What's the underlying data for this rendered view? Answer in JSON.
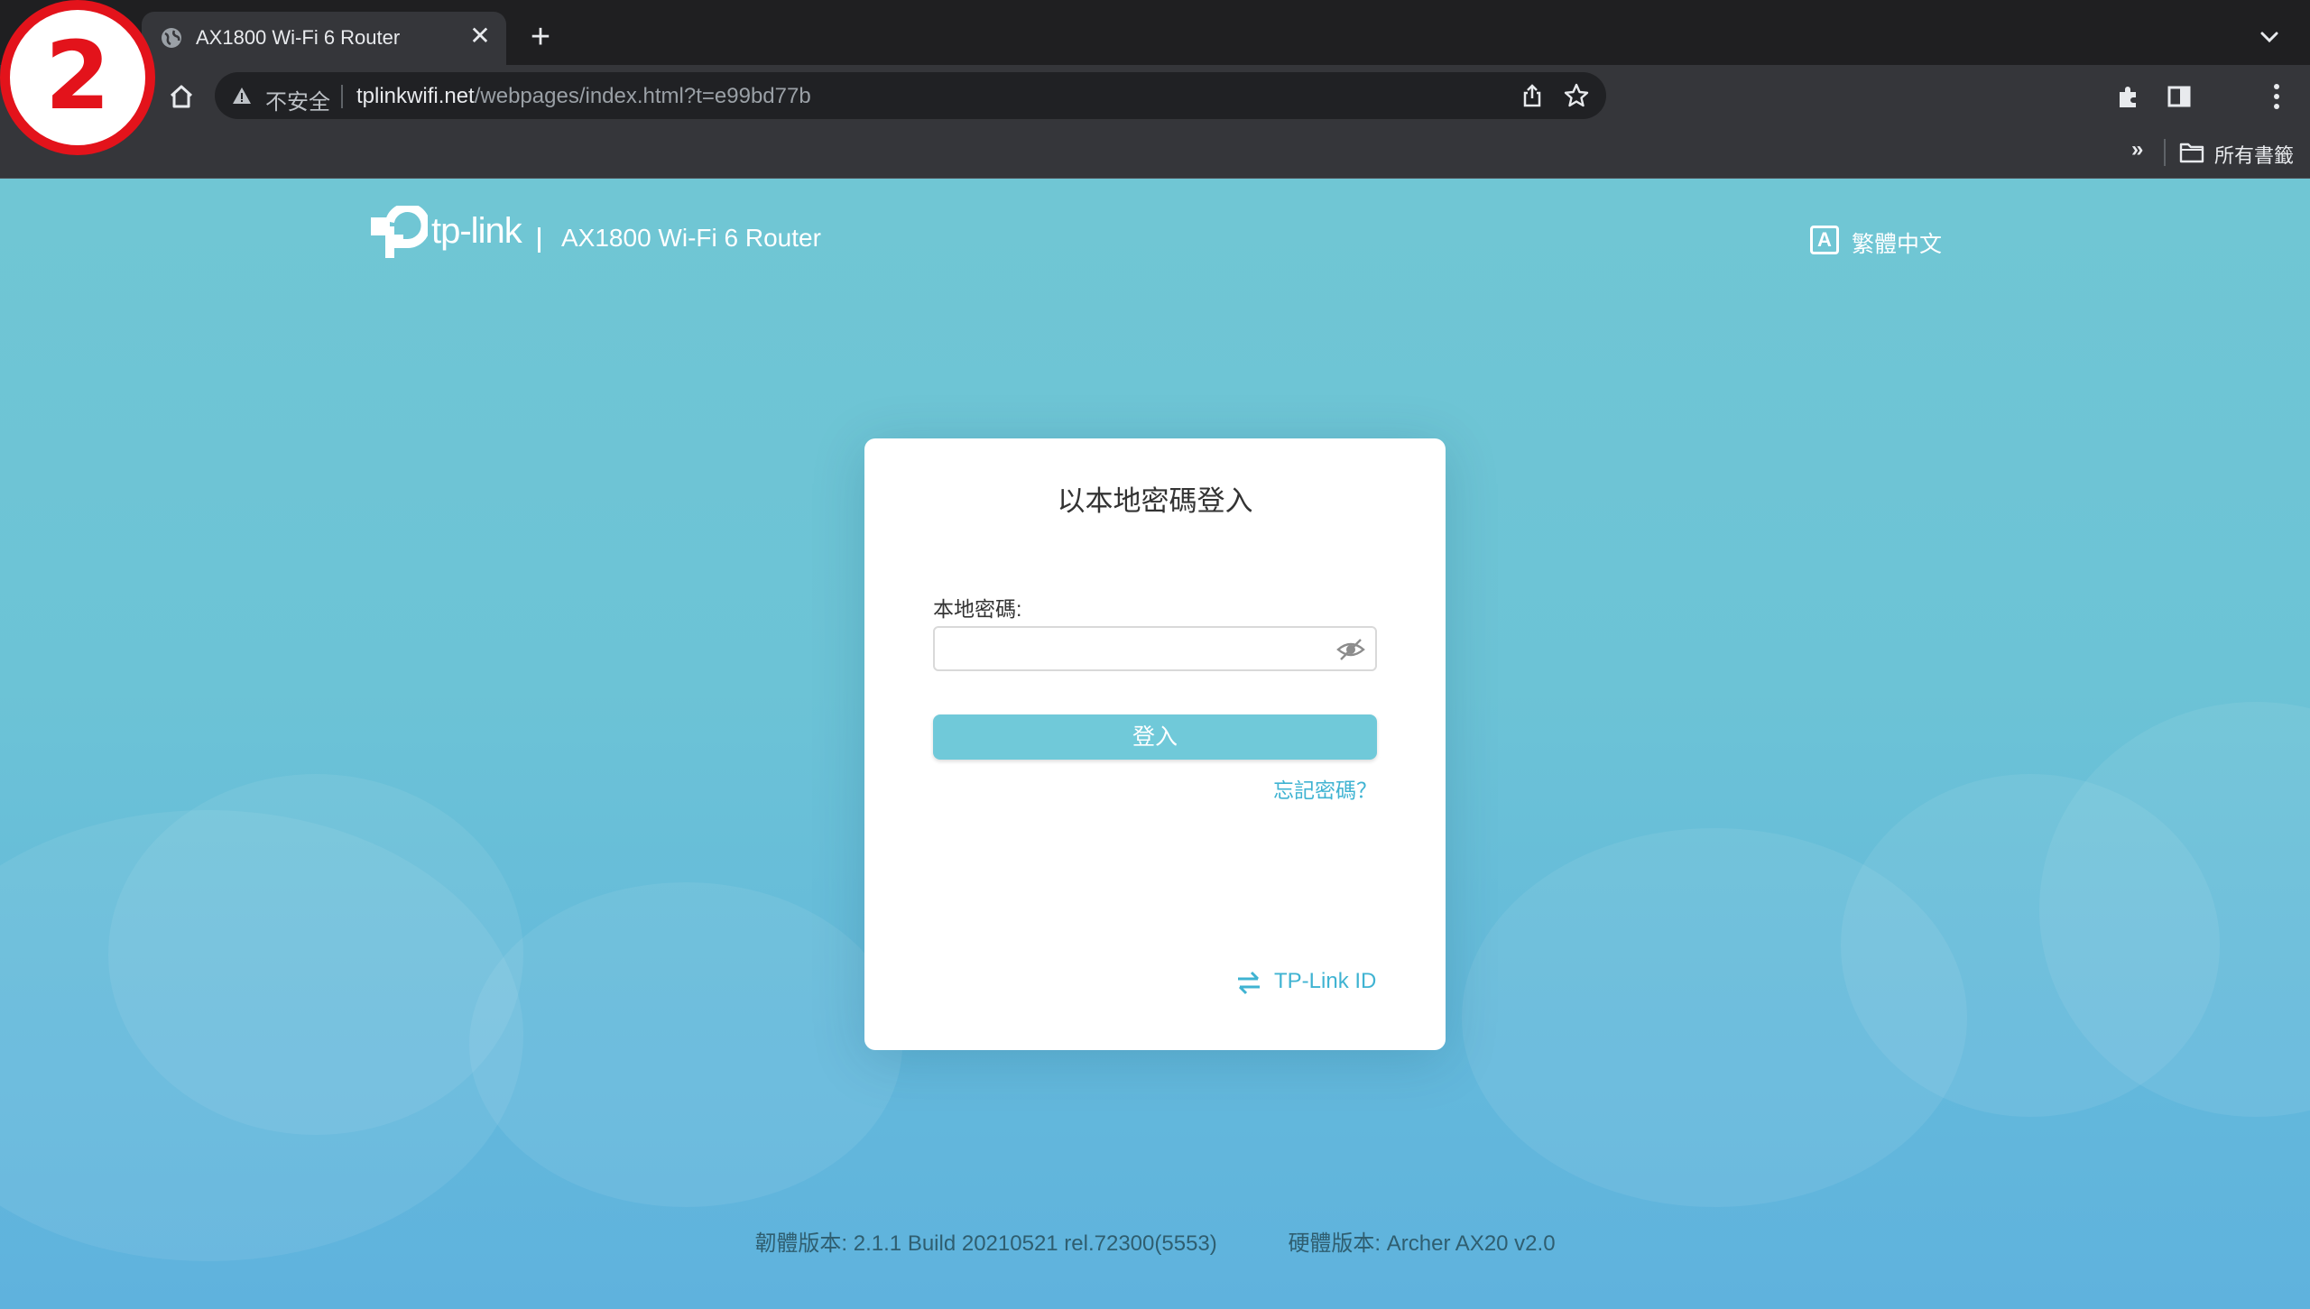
{
  "browser": {
    "tab": {
      "title": "AX1800 Wi-Fi 6 Router",
      "close_glyph": "✕"
    },
    "new_tab_glyph": "+",
    "address_bar": {
      "security_text": "不安全",
      "url_host": "tplinkwifi.net",
      "url_path": "/webpages/index.html?t=e99bd77b"
    },
    "bookmarks_bar": {
      "overflow_glyph": "»",
      "folder_label": "所有書籤"
    }
  },
  "step_badge": {
    "number": "2",
    "color": "#e3131b"
  },
  "page": {
    "brand": {
      "logo_text": "tp-link",
      "separator": "|",
      "model_title": "AX1800 Wi-Fi 6 Router"
    },
    "language": {
      "icon_letter": "A",
      "label": "繁體中文"
    },
    "login": {
      "title": "以本地密碼登入",
      "password_label": "本地密碼:",
      "password_value": "",
      "login_button": "登入",
      "forgot_link": "忘記密碼？",
      "tplink_id_link": "TP-Link ID"
    },
    "footer": {
      "firmware": "韌體版本: 2.1.1 Build 20210521 rel.72300(5553)",
      "hardware": "硬體版本: Archer AX20 v2.0"
    },
    "colors": {
      "accent": "#70c9d9",
      "link": "#3fb3d2",
      "background": "#6cc3d6"
    }
  }
}
